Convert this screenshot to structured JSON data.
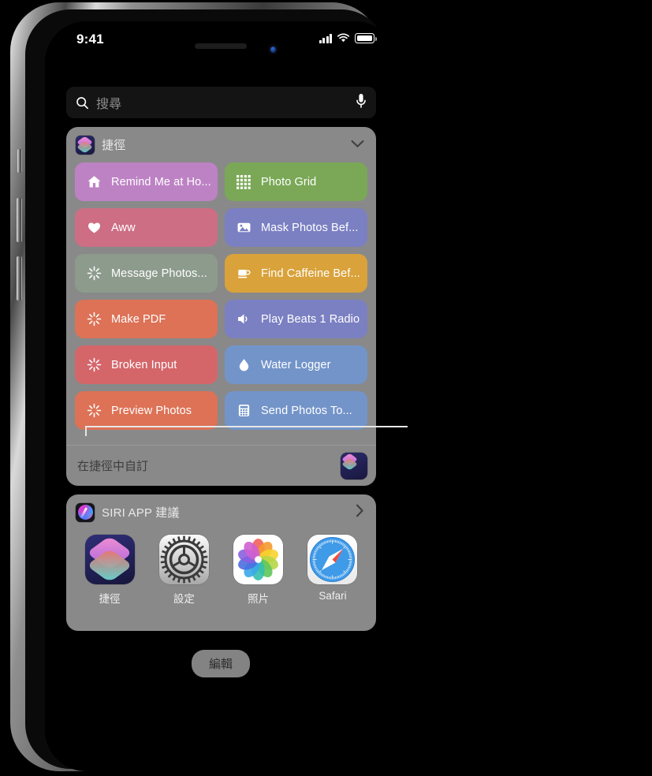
{
  "status_bar": {
    "time": "9:41",
    "signal_icon": "cellular-bars-icon",
    "wifi_icon": "wifi-icon",
    "battery_icon": "battery-full-icon"
  },
  "search": {
    "placeholder": "搜尋",
    "search_icon": "search-icon",
    "mic_icon": "microphone-icon"
  },
  "shortcuts_widget": {
    "app_icon": "shortcuts-app-icon",
    "title": "捷徑",
    "collapse_icon": "chevron-down-icon",
    "tiles": [
      {
        "label": "Remind Me at Ho...",
        "icon": "house-icon",
        "color": "#bd82c4"
      },
      {
        "label": "Photo Grid",
        "icon": "dot-grid-icon",
        "color": "#7aa857"
      },
      {
        "label": "Aww",
        "icon": "heart-icon",
        "color": "#cd6e85"
      },
      {
        "label": "Mask Photos Bef...",
        "icon": "photo-icon",
        "color": "#7b80c2"
      },
      {
        "label": "Message Photos...",
        "icon": "sparkle-burst-icon",
        "color": "#8d9b8d"
      },
      {
        "label": "Find Caffeine Bef...",
        "icon": "coffee-cup-icon",
        "color": "#d9a23a"
      },
      {
        "label": "Make PDF",
        "icon": "sparkle-burst-icon",
        "color": "#dd7256"
      },
      {
        "label": "Play Beats 1 Radio",
        "icon": "speaker-icon",
        "color": "#7b80c2"
      },
      {
        "label": "Broken Input",
        "icon": "sparkle-burst-icon",
        "color": "#d4666a"
      },
      {
        "label": "Water Logger",
        "icon": "water-drop-icon",
        "color": "#7394c9"
      },
      {
        "label": "Preview Photos",
        "icon": "sparkle-burst-icon",
        "color": "#dd7256"
      },
      {
        "label": "Send Photos To...",
        "icon": "calculator-icon",
        "color": "#7394c9"
      }
    ],
    "footer_label": "在捷徑中自訂",
    "footer_icon": "shortcuts-app-icon"
  },
  "siri_widget": {
    "app_icon": "siri-icon",
    "title": "SIRI APP 建議",
    "disclosure_icon": "chevron-right-icon",
    "apps": [
      {
        "name": "捷徑",
        "icon": "shortcuts-app-icon"
      },
      {
        "name": "設定",
        "icon": "settings-gear-icon"
      },
      {
        "name": "照片",
        "icon": "photos-app-icon"
      },
      {
        "name": "Safari",
        "icon": "safari-compass-icon"
      }
    ]
  },
  "edit_button": {
    "label": "編輯"
  },
  "callout": {
    "target": "在捷徑中自訂"
  }
}
